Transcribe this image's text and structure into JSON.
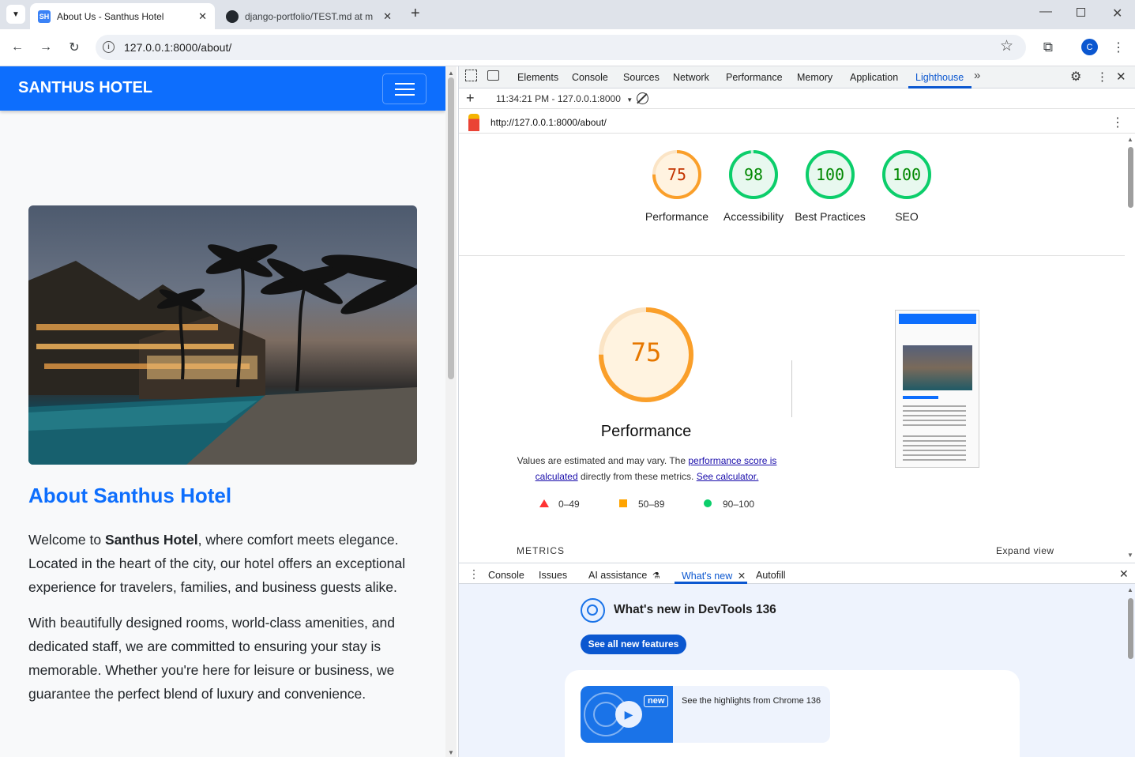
{
  "browser": {
    "tabs": [
      {
        "label": "About Us - Santhus Hotel",
        "favicon": "SH",
        "active": true
      },
      {
        "label": "django-portfolio/TEST.md at m",
        "favicon": "github-icon",
        "active": false
      }
    ],
    "url": "127.0.0.1:8000/about/",
    "profile_initial": "C"
  },
  "site": {
    "brand": "SANTHUS HOTEL",
    "about_title": "About Santhus Hotel",
    "para1_a": "Welcome to ",
    "para1_bold": "Santhus Hotel",
    "para1_b": ", where comfort meets elegance. Located in the heart of the city, our hotel offers an exceptional experience for travelers, families, and business guests alike.",
    "para2": "With beautifully designed rooms, world-class amenities, and dedicated staff, we are committed to ensuring your stay is memorable. Whether you're here for leisure or business, we guarantee the perfect blend of luxury and convenience.",
    "colors": {
      "brand": "#0d6efd"
    }
  },
  "devtools": {
    "tabs": [
      "Elements",
      "Console",
      "Sources",
      "Network",
      "Performance",
      "Memory",
      "Application",
      "Lighthouse"
    ],
    "active_tab": "Lighthouse",
    "report_selector": "11:34:21 PM - 127.0.0.1:8000",
    "report_url": "http://127.0.0.1:8000/about/",
    "scores": [
      {
        "label": "Performance",
        "value": 75,
        "color": "#fa9f2a"
      },
      {
        "label": "Accessibility",
        "value": 98,
        "color": "#0cce6b"
      },
      {
        "label": "Best Practices",
        "value": 100,
        "color": "#0cce6b"
      },
      {
        "label": "SEO",
        "value": 100,
        "color": "#0cce6b"
      }
    ],
    "perf": {
      "score": 75,
      "title": "Performance",
      "desc_a": "Values are estimated and may vary. The ",
      "desc_link1": "performance score is calculated",
      "desc_b": " directly from these metrics. ",
      "desc_link2": "See calculator.",
      "legend": [
        "0–49",
        "50–89",
        "90–100"
      ]
    },
    "metrics_label": "METRICS",
    "expand_label": "Expand view",
    "drawer": {
      "tabs": [
        "Console",
        "Issues",
        "AI assistance",
        "What's new",
        "Autofill"
      ],
      "active_tab": "What's new",
      "title": "What's new in DevTools 136",
      "button": "See all new features",
      "card_text": "See the highlights from Chrome 136",
      "badge": "new"
    }
  }
}
